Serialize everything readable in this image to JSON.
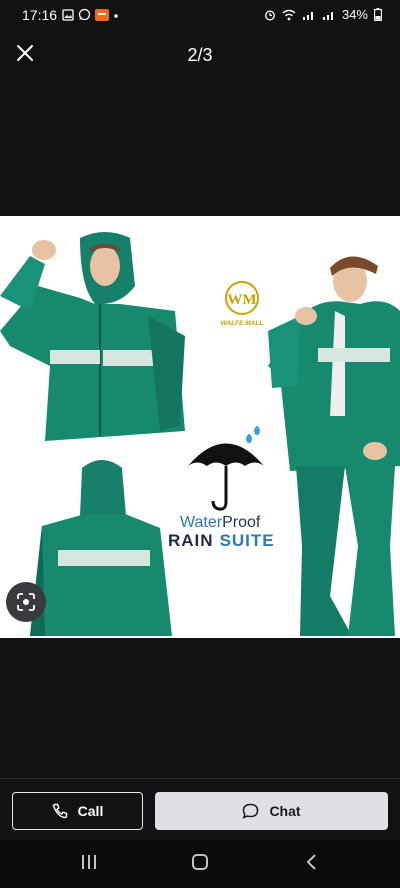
{
  "status_bar": {
    "time": "17:16",
    "battery": "34%"
  },
  "header": {
    "counter": "2/3"
  },
  "image": {
    "brand": "WALFE MALL",
    "brand_monogram": "WM",
    "tagline_part1": "Water",
    "tagline_part2": "Proof",
    "headline_part1": "RAIN",
    "headline_part2": "SUITE",
    "colors": {
      "raincoat": "#1a8c72",
      "brand_gold": "#c9a400",
      "blue_text": "#2b78b8",
      "navy_text": "#23345a"
    }
  },
  "actions": {
    "call_label": "Call",
    "chat_label": "Chat"
  },
  "icons": [
    "close-icon",
    "lens-icon",
    "phone-icon",
    "chat-bubble-icon",
    "recents-icon",
    "home-icon",
    "back-icon"
  ]
}
